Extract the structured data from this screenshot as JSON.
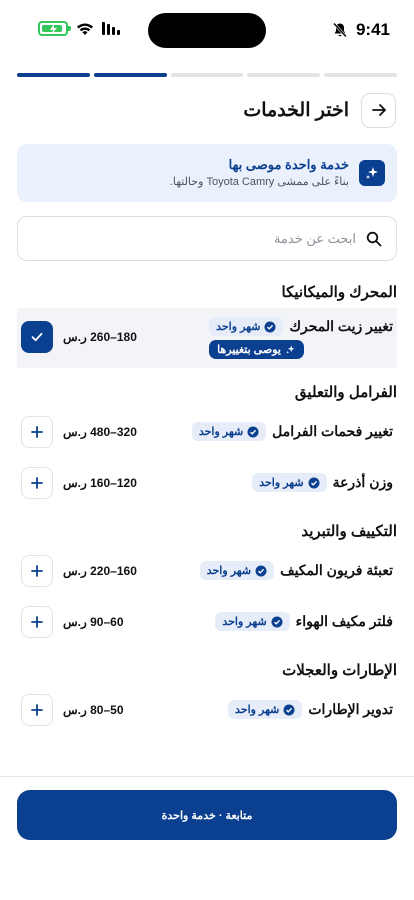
{
  "status_bar": {
    "time": "9:41"
  },
  "header": {
    "title": "اختر الخدمات"
  },
  "banner": {
    "title": "خدمة واحدة موصى بها",
    "subtitle": "بناءً على ممشى Toyota Camry وحالتها."
  },
  "search": {
    "placeholder": "ابحث عن خدمة",
    "value": ""
  },
  "sections": [
    {
      "title": "المحرك والميكانيكا",
      "items": [
        {
          "name": "تغيير زيت المحرك",
          "badge": "شهر واحد",
          "price": "180–260 ر.س",
          "recommended": "يوصى بتغييرها",
          "selected": true
        }
      ]
    },
    {
      "title": "الفرامل والتعليق",
      "items": [
        {
          "name": "تغيير فحمات الفرامل",
          "badge": "شهر واحد",
          "price": "320–480 ر.س",
          "selected": false
        },
        {
          "name": "وزن أذرعة",
          "badge": "شهر واحد",
          "price": "120–160 ر.س",
          "selected": false
        }
      ]
    },
    {
      "title": "التكييف والتبريد",
      "items": [
        {
          "name": "تعبئة فريون المكيف",
          "badge": "شهر واحد",
          "price": "160–220 ر.س",
          "selected": false
        },
        {
          "name": "فلتر مكيف الهواء",
          "badge": "شهر واحد",
          "price": "60–90 ر.س",
          "selected": false
        }
      ]
    },
    {
      "title": "الإطارات والعجلات",
      "items": [
        {
          "name": "تدوير الإطارات",
          "badge": "شهر واحد",
          "price": "50–80 ر.س",
          "selected": false
        }
      ]
    }
  ],
  "footer": {
    "cta_label": "متابعة · خدمة واحدة"
  },
  "progress": {
    "total_steps": 5,
    "completed_steps": 2
  },
  "colors": {
    "accent": "#0b3f8f",
    "accent_light": "#eaf1fc",
    "battery": "#34c759"
  }
}
